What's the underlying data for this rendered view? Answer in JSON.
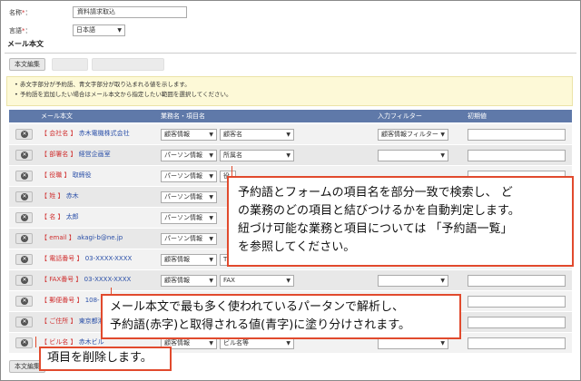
{
  "form": {
    "name_label": "名称",
    "name_required": "*",
    "name_suffix": "：",
    "name_value": "資料請求取込",
    "lang_label": "言語",
    "lang_required": "*",
    "lang_suffix": "：",
    "lang_value": "日本語"
  },
  "section_title": "メール本文",
  "toolbar": {
    "edit_label": "本文編集",
    "btn2_label": "",
    "btn3_label": ""
  },
  "notes": [
    "赤文字部分が予約語、青文字部分が取り込まれる値を示します。",
    "予約語を追加したい場合はメール本文から指定したい範囲を選択してください。"
  ],
  "table": {
    "headers": [
      "メール本文",
      "業務名・項目名",
      "入力フィルター",
      "初期値"
    ],
    "rows": [
      {
        "key": "【 会社名 】",
        "value": "赤木電機株式会社",
        "business": "顧客情報",
        "field": "顧客名",
        "filter": "顧客情報フィルター"
      },
      {
        "key": "【 部署名 】",
        "value": "経営企画室",
        "business": "パーソン情報",
        "field": "所属名",
        "filter": ""
      },
      {
        "key": "【 役職 】",
        "value": "取締役",
        "business": "パーソン情報",
        "field": "役",
        "filter": ""
      },
      {
        "key": "【 姓 】",
        "value": "赤木",
        "business": "パーソン情報",
        "field": "",
        "filter": ""
      },
      {
        "key": "【 名 】",
        "value": "太郎",
        "business": "パーソン情報",
        "field": "",
        "filter": ""
      },
      {
        "key": "【 email 】",
        "value": "akagi-b@ne.jp",
        "business": "パーソン情報",
        "field": "",
        "filter": ""
      },
      {
        "key": "【 電話番号 】",
        "value": "03-XXXX-XXXX",
        "business": "顧客情報",
        "field": "T",
        "filter": ""
      },
      {
        "key": "【 FAX番号 】",
        "value": "03-XXXX-XXXX",
        "business": "顧客情報",
        "field": "FAX",
        "filter": ""
      },
      {
        "key": "【 郵便番号 】",
        "value": "108-",
        "business": "",
        "field": "",
        "filter": ""
      },
      {
        "key": "【 ご住所 】",
        "value": "東京都港",
        "business": "",
        "field": "",
        "filter": ""
      },
      {
        "key": "【 ビル名 】",
        "value": "赤木ビル",
        "business": "顧客情報",
        "field": "ビル名等",
        "filter": ""
      }
    ]
  },
  "bottom_button": "本文編集",
  "callouts": {
    "c1": [
      "予約語とフォームの項目名を部分一致で検索し、 ど",
      "の業務のどの項目と結びつけるかを自動判定します。",
      "紐づけ可能な業務と項目については 「予約語一覧」",
      "を参照してください。"
    ],
    "c2": [
      "メール本文で最も多く使われているパータンで解析し、",
      "予約語(赤字)と取得される値(青字)に塗り分けされます。"
    ],
    "c3": [
      "項目を削除します。"
    ]
  },
  "colors": {
    "accent": "#e14a2d",
    "header": "#5f79a9",
    "reserved": "#d03030",
    "value": "#2a4fa8"
  }
}
